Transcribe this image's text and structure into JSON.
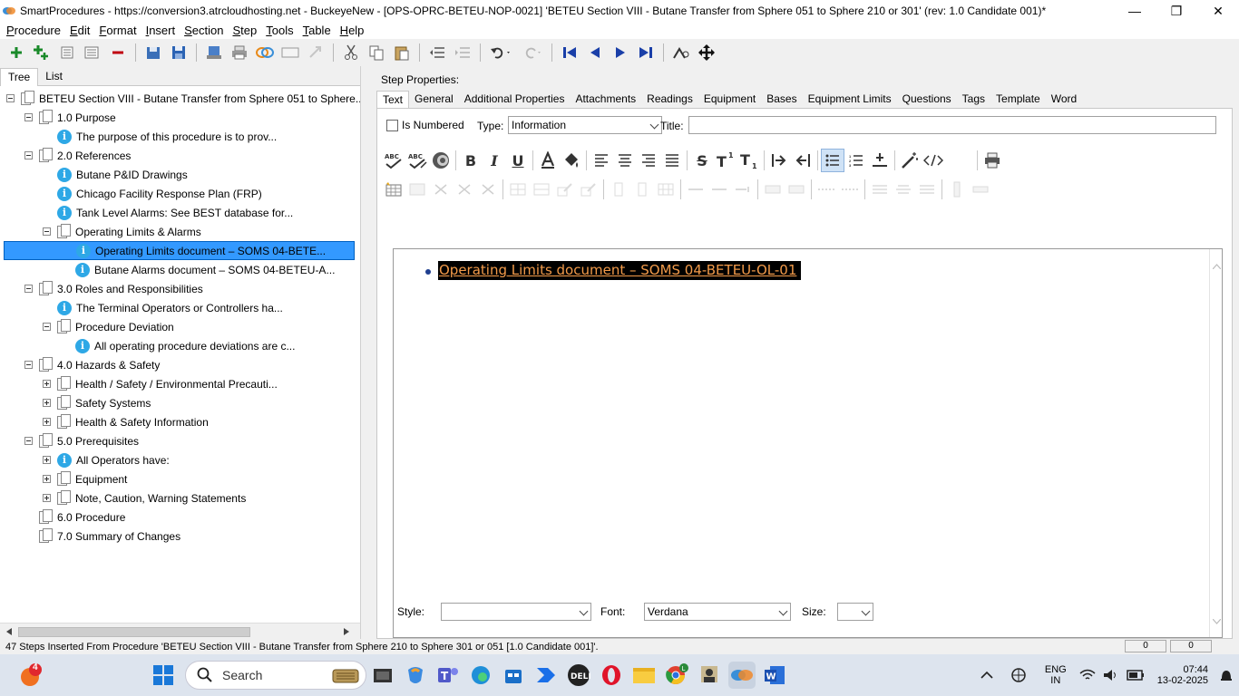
{
  "window": {
    "title": "SmartProcedures - https://conversion3.atrcloudhosting.net - BuckeyeNew - [OPS-OPRC-BETEU-NOP-0021] 'BETEU Section VIII - Butane Transfer from Sphere 051 to Sphere 210 or 301' (rev: 1.0 Candidate 001)*"
  },
  "menu": [
    "Procedure",
    "Edit",
    "Format",
    "Insert",
    "Section",
    "Step",
    "Tools",
    "Table",
    "Help"
  ],
  "left_tabs": [
    "Tree",
    "List"
  ],
  "tree": [
    {
      "level": 0,
      "type": "folder",
      "expander": "minus",
      "label": "BETEU Section VIII - Butane Transfer from Sphere 051 to Sphere..."
    },
    {
      "level": 1,
      "type": "folder",
      "expander": "minus",
      "label": "1.0 Purpose"
    },
    {
      "level": 2,
      "type": "info",
      "expander": "",
      "label": "The purpose of this procedure is to prov..."
    },
    {
      "level": 1,
      "type": "folder",
      "expander": "minus",
      "label": "2.0 References"
    },
    {
      "level": 2,
      "type": "info",
      "expander": "",
      "label": "Butane P&ID Drawings"
    },
    {
      "level": 2,
      "type": "info",
      "expander": "",
      "label": "Chicago Facility Response Plan (FRP)"
    },
    {
      "level": 2,
      "type": "info",
      "expander": "",
      "label": "Tank Level Alarms: See BEST database for..."
    },
    {
      "level": 2,
      "type": "folder",
      "expander": "minus",
      "label": "Operating Limits & Alarms"
    },
    {
      "level": 3,
      "type": "info",
      "expander": "",
      "label": "Operating Limits document – SOMS 04-BETE...",
      "selected": true
    },
    {
      "level": 3,
      "type": "info",
      "expander": "",
      "label": "Butane Alarms document – SOMS 04-BETEU-A..."
    },
    {
      "level": 1,
      "type": "folder",
      "expander": "minus",
      "label": "3.0 Roles and Responsibilities"
    },
    {
      "level": 2,
      "type": "info",
      "expander": "",
      "label": "The Terminal Operators or Controllers ha..."
    },
    {
      "level": 2,
      "type": "folder",
      "expander": "minus",
      "label": "Procedure Deviation"
    },
    {
      "level": 3,
      "type": "info",
      "expander": "",
      "label": "All operating procedure deviations are c..."
    },
    {
      "level": 1,
      "type": "folder",
      "expander": "minus",
      "label": "4.0 Hazards & Safety"
    },
    {
      "level": 2,
      "type": "folder",
      "expander": "plus",
      "label": "Health / Safety / Environmental Precauti..."
    },
    {
      "level": 2,
      "type": "folder",
      "expander": "plus",
      "label": "Safety Systems"
    },
    {
      "level": 2,
      "type": "folder",
      "expander": "plus",
      "label": "Health & Safety Information"
    },
    {
      "level": 1,
      "type": "folder",
      "expander": "minus",
      "label": "5.0 Prerequisites"
    },
    {
      "level": 2,
      "type": "info",
      "expander": "plus",
      "label": "All Operators have:"
    },
    {
      "level": 2,
      "type": "folder",
      "expander": "plus",
      "label": "Equipment"
    },
    {
      "level": 2,
      "type": "folder",
      "expander": "plus",
      "label": "Note, Caution, Warning Statements"
    },
    {
      "level": 1,
      "type": "folder",
      "expander": "",
      "label": "6.0 Procedure"
    },
    {
      "level": 1,
      "type": "folder",
      "expander": "",
      "label": "7.0 Summary of Changes"
    }
  ],
  "step_properties": {
    "label": "Step Properties:",
    "tabs": [
      "Text",
      "General",
      "Additional Properties",
      "Attachments",
      "Readings",
      "Equipment",
      "Bases",
      "Equipment Limits",
      "Questions",
      "Tags",
      "Template",
      "Word"
    ],
    "is_numbered_label": "Is Numbered",
    "type_label": "Type:",
    "type_value": "Information",
    "title_label": "Title:",
    "title_value": "",
    "editor_text": "Operating Limits document – SOMS 04-BETEU-OL-01",
    "style_label": "Style:",
    "style_value": "",
    "font_label": "Font:",
    "font_value": "Verdana",
    "size_label": "Size:",
    "size_value": ""
  },
  "status": {
    "message": "47 Steps Inserted From Procedure 'BETEU Section VIII - Butane Transfer from Sphere 210 to Sphere 301 or 051 [1.0 Candidate 001]'.",
    "field1": "0",
    "field2": "0"
  },
  "taskbar": {
    "search_placeholder": "Search",
    "notification_count": "4",
    "language_top": "ENG",
    "language_bottom": "IN",
    "time": "07:44",
    "date": "13-02-2025"
  },
  "colors": {
    "selection": "#3399ff",
    "highlight_text": "#f39b4a",
    "info_icon": "#2ea8e6"
  }
}
